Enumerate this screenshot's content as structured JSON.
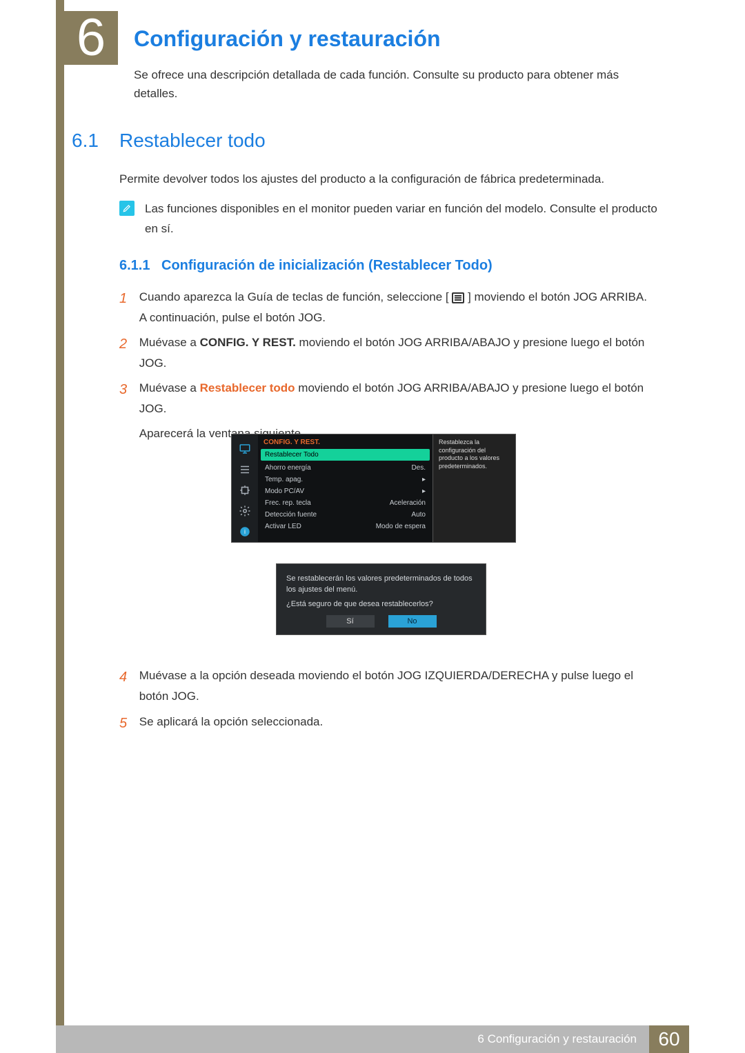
{
  "chapter": {
    "number": "6",
    "title": "Configuración y restauración",
    "intro": "Se ofrece una descripción detallada de cada función. Consulte su producto para obtener más detalles."
  },
  "section": {
    "number": "6.1",
    "title": "Restablecer todo",
    "desc": "Permite devolver todos los ajustes del producto a la configuración de fábrica predeterminada.",
    "note": "Las funciones disponibles en el monitor pueden variar en función del modelo. Consulte el producto en sí."
  },
  "subsection": {
    "number": "6.1.1",
    "title": "Configuración de inicialización (Restablecer Todo)"
  },
  "steps": {
    "s1_a": "Cuando aparezca la Guía de teclas de función, seleccione [",
    "s1_b": "] moviendo el botón JOG ARRIBA. A continuación, pulse el botón JOG.",
    "s2_a": "Muévase a ",
    "s2_bold": "CONFIG. Y REST.",
    "s2_b": " moviendo el botón JOG ARRIBA/ABAJO y presione luego el botón JOG.",
    "s3_a": "Muévase a ",
    "s3_bold": "Restablecer todo",
    "s3_b": " moviendo el botón JOG ARRIBA/ABAJO y presione luego el botón JOG.",
    "s3_c": "Aparecerá la ventana siguiente.",
    "s4": "Muévase a la opción deseada moviendo el botón JOG IZQUIERDA/DERECHA y pulse luego el botón JOG.",
    "s5": "Se aplicará la opción seleccionada.",
    "n1": "1",
    "n2": "2",
    "n3": "3",
    "n4": "4",
    "n5": "5"
  },
  "osd": {
    "header": "CONFIG. Y REST.",
    "tooltip": "Restablezca la configuración del producto a los valores predeterminados.",
    "rows": [
      {
        "label": "Restablecer Todo",
        "value": ""
      },
      {
        "label": "Ahorro energía",
        "value": "Des."
      },
      {
        "label": "Temp. apag.",
        "value": "▸"
      },
      {
        "label": "Modo PC/AV",
        "value": "▸"
      },
      {
        "label": "Frec. rep. tecla",
        "value": "Aceleración"
      },
      {
        "label": "Detección fuente",
        "value": "Auto"
      },
      {
        "label": "Activar LED",
        "value": "Modo de espera"
      }
    ],
    "dialog": {
      "msg": "Se restablecerán los valores predeterminados de todos los ajustes del menú.",
      "question": "¿Está seguro de que desea restablecerlos?",
      "yes": "Sí",
      "no": "No"
    }
  },
  "footer": {
    "label": "6 Configuración y restauración",
    "page": "60"
  }
}
